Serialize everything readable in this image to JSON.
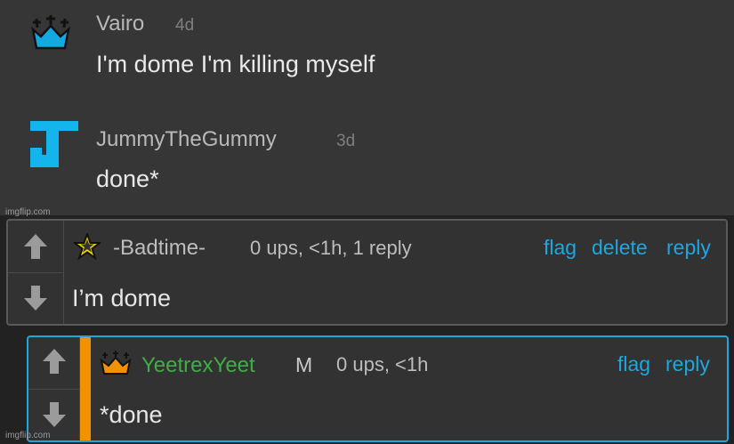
{
  "messages": [
    {
      "username": "Vairo",
      "time": "4d",
      "text": "I'm dome I'm killing myself",
      "avatar_icon": "blue-crown-icon",
      "avatar_color": "#14a8e0"
    },
    {
      "username": "JummyTheGummy",
      "time": "3d",
      "text": "done*",
      "avatar_icon": "j-letter-icon",
      "avatar_color": "#14b5ec"
    }
  ],
  "watermark": "imgflip.com",
  "comments": [
    {
      "username": "-Badtime-",
      "user_color": "#bdbdbd",
      "badge_icon": "yellow-star-icon",
      "meta": "0 ups, <1h, 1 reply",
      "links": {
        "flag": "flag",
        "delete": "delete",
        "reply": "reply"
      },
      "text": "I’m dome",
      "border_color": "#5a5a5a"
    },
    {
      "username": "YeetrexYeet",
      "user_color": "#3fae49",
      "badge_icon": "orange-crown-icon",
      "mod_badge": "M",
      "meta": "0 ups, <1h",
      "links": {
        "flag": "flag",
        "reply": "reply"
      },
      "text": "*done",
      "border_color": "#1ea6e0",
      "accent_color": "#f39200"
    }
  ],
  "colors": {
    "link": "#1ea6e0",
    "top_bg": "#363636",
    "bottom_bg": "#222222"
  }
}
